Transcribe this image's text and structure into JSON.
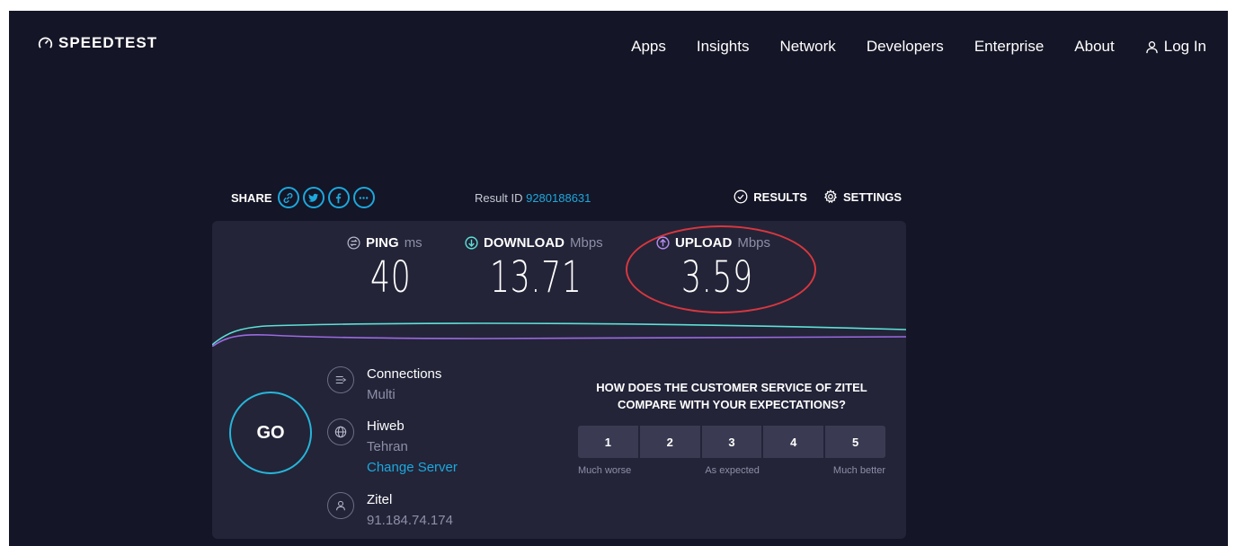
{
  "nav": {
    "logo_text": "SPEEDTEST",
    "links": [
      "Apps",
      "Insights",
      "Network",
      "Developers",
      "Enterprise",
      "About"
    ],
    "login_label": "Log In"
  },
  "toolbar": {
    "share_label": "SHARE",
    "share_icons": [
      "link-icon",
      "twitter-icon",
      "facebook-icon",
      "more-icon"
    ],
    "result_prefix": "Result ID",
    "result_id": "9280188631",
    "results_label": "RESULTS",
    "settings_label": "SETTINGS"
  },
  "metrics": {
    "ping": {
      "label": "PING",
      "unit": "ms",
      "value": "40"
    },
    "download": {
      "label": "DOWNLOAD",
      "unit": "Mbps",
      "value": "13.71"
    },
    "upload": {
      "label": "UPLOAD",
      "unit": "Mbps",
      "value": "3.59"
    }
  },
  "go_label": "GO",
  "connection": {
    "connections_title": "Connections",
    "connections_value": "Multi",
    "server_name": "Hiweb",
    "server_location": "Tehran",
    "change_server_label": "Change Server",
    "isp_name": "Zitel",
    "ip_address": "91.184.74.174"
  },
  "survey": {
    "question": "HOW DOES THE CUSTOMER SERVICE OF ZITEL COMPARE WITH YOUR EXPECTATIONS?",
    "ratings": [
      "1",
      "2",
      "3",
      "4",
      "5"
    ],
    "low_label": "Much worse",
    "mid_label": "As expected",
    "high_label": "Much better"
  },
  "colors": {
    "background": "#141526",
    "card": "#232438",
    "accent_blue": "#1ca8dd",
    "download_line": "#5ee0d6",
    "upload_line": "#9c6ae0",
    "highlight_ring": "#d8373e"
  }
}
